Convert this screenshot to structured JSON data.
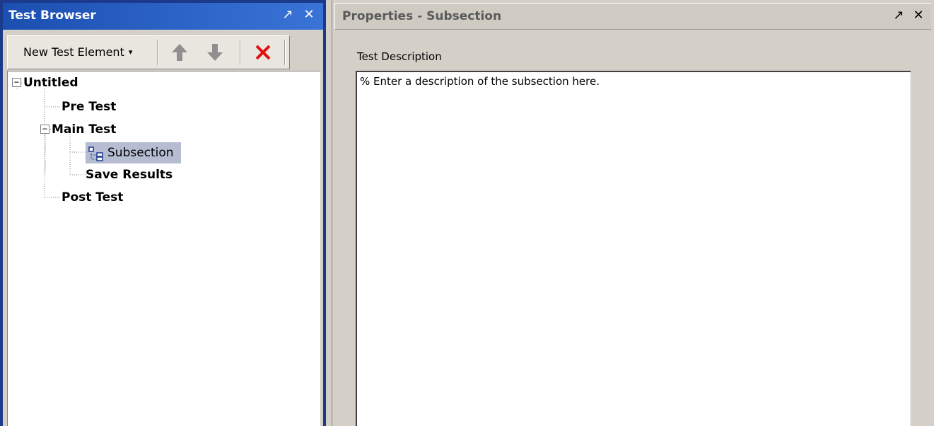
{
  "test_browser": {
    "title": "Test Browser",
    "pin_glyph": "↗",
    "close_glyph": "✕",
    "toolbar": {
      "new_element_label": "New Test Element",
      "dropdown_glyph": "▾",
      "move_up_icon": "arrow-up-icon",
      "move_down_icon": "arrow-down-icon",
      "delete_icon": "delete-x-icon",
      "colors": {
        "arrows": "#8f8f8f",
        "delete": "#e01010"
      }
    },
    "tree": {
      "root": {
        "label": "Untitled",
        "expanded": true,
        "toggle": "−"
      },
      "items": [
        {
          "label": "Pre Test"
        },
        {
          "label": "Main Test",
          "expanded": true,
          "toggle": "−",
          "children": [
            {
              "label": "Subsection",
              "selected": true,
              "icon": "subsection-icon"
            },
            {
              "label": "Save Results"
            }
          ]
        },
        {
          "label": "Post Test"
        }
      ]
    },
    "colors": {
      "title_bar": "#2d65c8",
      "selection": "#b6bdd2",
      "frame": "#1c3a8c"
    }
  },
  "properties": {
    "title": "Properties - Subsection",
    "pin_glyph": "↗",
    "close_glyph": "✕",
    "description_label": "Test Description",
    "description_value": "% Enter a description of the subsection here."
  }
}
